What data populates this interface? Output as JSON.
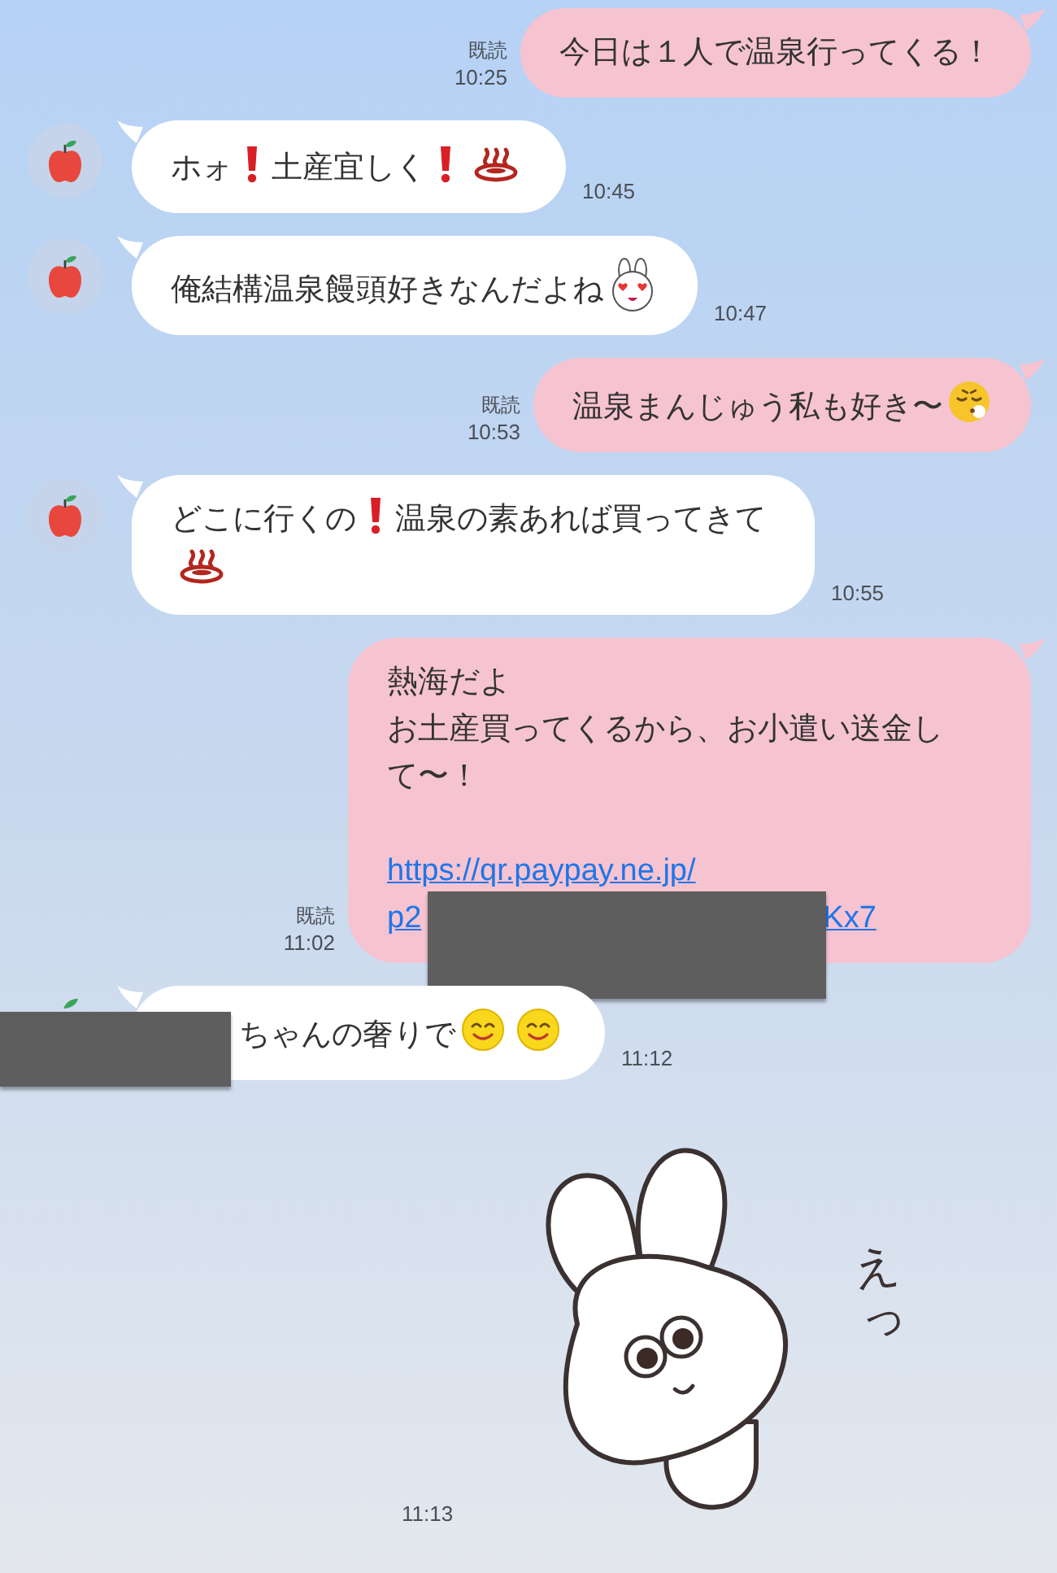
{
  "messages": [
    {
      "kind": "sent",
      "read_label": "既読",
      "time": "10:25",
      "parts": [
        {
          "kind": "text",
          "text": "今日は１人で温泉行ってくる！"
        }
      ]
    },
    {
      "kind": "received",
      "time": "10:45",
      "parts": [
        {
          "kind": "text",
          "text": "ホォ"
        },
        {
          "kind": "exclamation"
        },
        {
          "kind": "text",
          "text": "土産宜しく"
        },
        {
          "kind": "exclamation"
        },
        {
          "kind": "onsen"
        }
      ]
    },
    {
      "kind": "received",
      "time": "10:47",
      "parts": [
        {
          "kind": "text",
          "text": "俺結構温泉饅頭好きなんだよね"
        },
        {
          "kind": "rabbit"
        }
      ]
    },
    {
      "kind": "sent",
      "read_label": "既読",
      "time": "10:53",
      "parts": [
        {
          "kind": "text",
          "text": "温泉まんじゅう私も好き〜"
        },
        {
          "kind": "sigh"
        }
      ]
    },
    {
      "kind": "received",
      "time": "10:55",
      "parts": [
        {
          "kind": "text",
          "text": "どこに行くの"
        },
        {
          "kind": "exclamation"
        },
        {
          "kind": "text",
          "text": "温泉の素あれば買ってきて"
        },
        {
          "kind": "onsen"
        }
      ]
    },
    {
      "kind": "sent",
      "read_label": "既読",
      "time": "11:02",
      "redacted": true,
      "parts": [
        {
          "kind": "line",
          "text": "熱海だよ"
        },
        {
          "kind": "line",
          "text": "お土産買ってくるから、お小遣い送金して〜！"
        }
      ],
      "link": {
        "line": "https://qr.paypay.ne.jp/",
        "start": "p2",
        "end": "Kx7"
      }
    },
    {
      "kind": "received",
      "time": "11:12",
      "redacted": true,
      "parts": [
        {
          "kind": "text",
          "text": "ちゃんの奢りで"
        },
        {
          "kind": "smile"
        },
        {
          "kind": "smile"
        }
      ]
    },
    {
      "kind": "sticker",
      "time": "11:13",
      "sticker_text": "えっ"
    }
  ]
}
